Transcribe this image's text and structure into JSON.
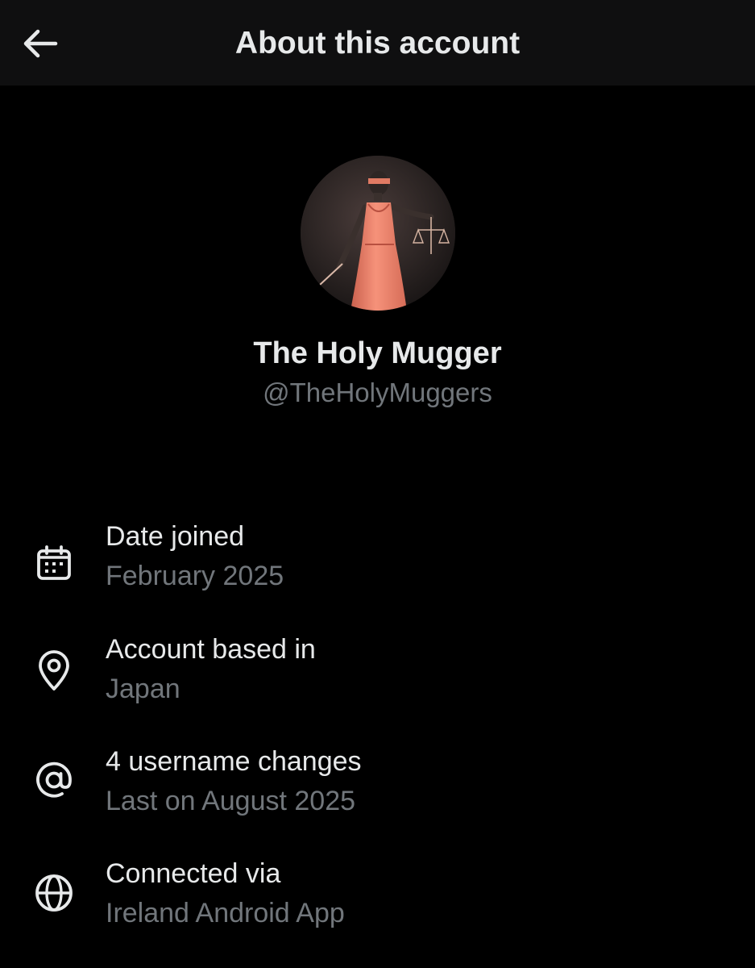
{
  "header": {
    "title": "About this account",
    "back_icon": "arrow-left-icon"
  },
  "profile": {
    "name": "The Holy Mugger",
    "handle": "@TheHolyMuggers",
    "avatar_icon": "profile-avatar"
  },
  "details": [
    {
      "icon": "calendar-icon",
      "label": "Date joined",
      "value": "February 2025"
    },
    {
      "icon": "location-pin-icon",
      "label": "Account based in",
      "value": "Japan"
    },
    {
      "icon": "at-sign-icon",
      "label": "4 username changes",
      "value": "Last on August 2025"
    },
    {
      "icon": "globe-icon",
      "label": "Connected via",
      "value": "Ireland Android App"
    }
  ],
  "colors": {
    "background": "#000000",
    "header_bg": "#0f0f10",
    "primary_text": "#e7e9ea",
    "secondary_text": "#71767b",
    "avatar_dress": "#f2846b"
  }
}
